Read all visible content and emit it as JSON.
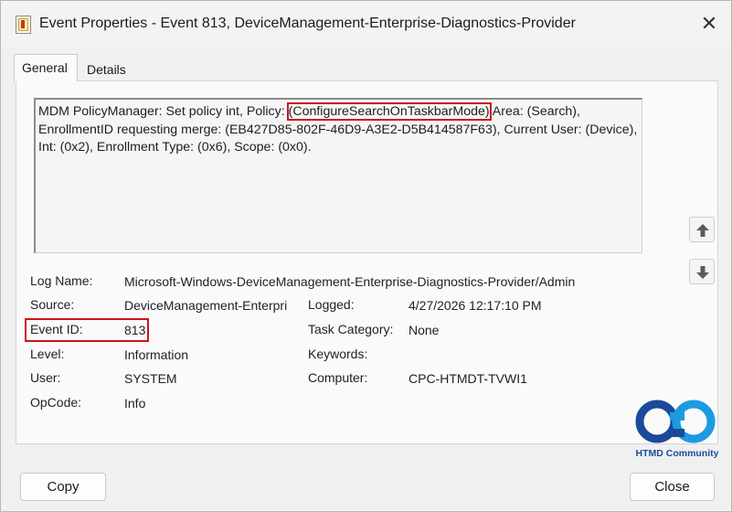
{
  "window": {
    "title": "Event Properties - Event 813, DeviceManagement-Enterprise-Diagnostics-Provider",
    "close_glyph": "✕"
  },
  "tabs": [
    {
      "label": "General",
      "selected": true
    },
    {
      "label": "Details",
      "selected": false
    }
  ],
  "description": {
    "before": "MDM PolicyManager: Set policy int, Policy: ",
    "highlighted": "(ConfigureSearchOnTaskbarMode)",
    "after": " Area: (Search), EnrollmentID requesting merge: (EB427D85-802F-46D9-A3E2-D5B414587F63), Current User: (Device), Int: (0x2), Enrollment Type: (0x6), Scope: (0x0)."
  },
  "fields": {
    "log_name": {
      "label": "Log Name:",
      "value": "Microsoft-Windows-DeviceManagement-Enterprise-Diagnostics-Provider/Admin"
    },
    "source": {
      "label": "Source:",
      "value": "DeviceManagement-Enterpri"
    },
    "logged": {
      "label": "Logged:",
      "value": "4/27/2026 12:17:10 PM"
    },
    "event_id": {
      "label": "Event ID:",
      "value": "813"
    },
    "task_category": {
      "label": "Task Category:",
      "value": "None"
    },
    "level": {
      "label": "Level:",
      "value": "Information"
    },
    "keywords": {
      "label": "Keywords:",
      "value": ""
    },
    "user": {
      "label": "User:",
      "value": "SYSTEM"
    },
    "computer": {
      "label": "Computer:",
      "value": "CPC-HTMDT-TVWI1"
    },
    "opcode": {
      "label": "OpCode:",
      "value": "Info"
    }
  },
  "icons": {
    "up": "arrow-up-icon",
    "down": "arrow-down-icon"
  },
  "logo": {
    "text": "HTMD Community",
    "color": "#1b4a9a",
    "accent": "#1e9be0"
  },
  "buttons": {
    "copy": "Copy",
    "close": "Close"
  },
  "colors": {
    "highlight": "#d0121b"
  }
}
